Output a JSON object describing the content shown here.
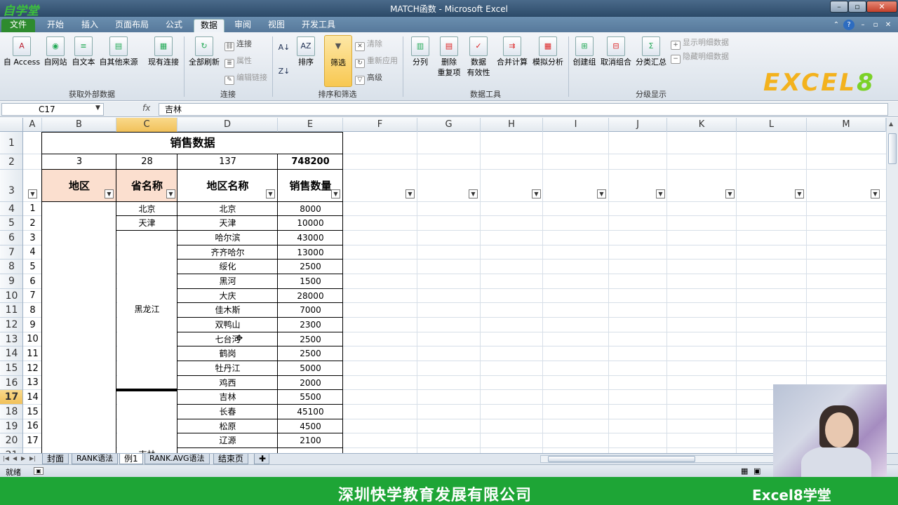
{
  "window": {
    "title": "MATCH函数 - Microsoft Excel",
    "brand": "自学堂",
    "buttons": {
      "minimize": "–",
      "restore": "▫",
      "close": "✕"
    }
  },
  "tabs": [
    "文件",
    "开始",
    "插入",
    "页面布局",
    "公式",
    "数据",
    "审阅",
    "视图",
    "开发工具"
  ],
  "active_tab": "数据",
  "ribbon": {
    "groups": [
      {
        "name": "获取外部数据"
      },
      {
        "name": "连接"
      },
      {
        "name": "排序和筛选"
      },
      {
        "name": "数据工具"
      },
      {
        "name": "分级显示"
      }
    ],
    "get_external": [
      "自 Access",
      "自网站",
      "自文本",
      "自其他来源",
      "现有连接"
    ],
    "connections": {
      "refresh": "全部刷新",
      "connect": "连接",
      "properties": "属性",
      "edit_links": "编辑链接"
    },
    "sort_filter": {
      "sort": "排序",
      "filter": "筛选",
      "clear": "清除",
      "reapply": "重新应用",
      "advanced": "高级"
    },
    "data_tools": {
      "split": "分列",
      "remove_dup_1": "删除",
      "remove_dup_2": "重复项",
      "validation_1": "数据",
      "validation_2": "有效性",
      "consolidate": "合并计算",
      "whatif": "模拟分析"
    },
    "outline": {
      "group": "创建组",
      "ungroup": "取消组合",
      "subtotal": "分类汇总",
      "show_detail": "显示明细数据",
      "hide_detail": "隐藏明细数据"
    }
  },
  "logo": {
    "text1": "EXCEL",
    "text2": "8"
  },
  "formula_bar": {
    "name_box": "C17",
    "fx": "fx",
    "value": "吉林"
  },
  "columns": [
    "A",
    "B",
    "C",
    "D",
    "E",
    "F",
    "G",
    "H",
    "I",
    "J",
    "K",
    "L",
    "M"
  ],
  "active_column": "C",
  "row_numbers": [
    "1",
    "2",
    "3",
    "4",
    "5",
    "6",
    "7",
    "8",
    "9",
    "10",
    "11",
    "12",
    "13",
    "14",
    "15",
    "16",
    "17",
    "18",
    "19",
    "20",
    "21"
  ],
  "active_row": "17",
  "sheet": {
    "title": "销售数据",
    "stats": [
      "3",
      "28",
      "137",
      "748200"
    ],
    "headers": [
      "地区",
      "省名称",
      "地区名称",
      "销售数量"
    ],
    "rows": [
      {
        "idx": "1",
        "city": "北京",
        "qty": "8000"
      },
      {
        "idx": "2",
        "city": "天津",
        "qty": "10000"
      },
      {
        "idx": "3",
        "city": "哈尔滨",
        "qty": "43000"
      },
      {
        "idx": "4",
        "city": "齐齐哈尔",
        "qty": "13000"
      },
      {
        "idx": "5",
        "city": "绥化",
        "qty": "2500"
      },
      {
        "idx": "6",
        "city": "黑河",
        "qty": "1500"
      },
      {
        "idx": "7",
        "city": "大庆",
        "qty": "28000"
      },
      {
        "idx": "8",
        "city": "佳木斯",
        "qty": "7000"
      },
      {
        "idx": "9",
        "city": "双鸭山",
        "qty": "2300"
      },
      {
        "idx": "10",
        "city": "七台河",
        "qty": "2500"
      },
      {
        "idx": "11",
        "city": "鹤岗",
        "qty": "2500"
      },
      {
        "idx": "12",
        "city": "牡丹江",
        "qty": "5000"
      },
      {
        "idx": "13",
        "city": "鸡西",
        "qty": "2000"
      },
      {
        "idx": "14",
        "city": "吉林",
        "qty": "5500"
      },
      {
        "idx": "15",
        "city": "长春",
        "qty": "45100"
      },
      {
        "idx": "16",
        "city": "松原",
        "qty": "4500"
      },
      {
        "idx": "17",
        "city": "辽源",
        "qty": "2100"
      }
    ],
    "provinces": {
      "beijing": "北京",
      "tianjin": "天津",
      "heilongjiang": "黑龙江",
      "jilin": "吉林"
    }
  },
  "sheet_tabs": [
    "封面",
    "RANK语法",
    "例1",
    "RANK.AVG语法",
    "结束页"
  ],
  "active_sheet": "例1",
  "status": {
    "ready": "就绪"
  },
  "banner": {
    "company": "深圳快学教育发展有限公司",
    "brand": "Excel8学堂"
  }
}
